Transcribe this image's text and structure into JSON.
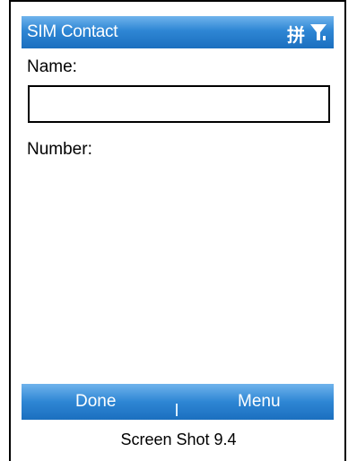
{
  "titlebar": {
    "title": "SIM Contact",
    "ime_indicator": "拼",
    "signal_icon": "signal-antenna-icon"
  },
  "form": {
    "name_label": "Name:",
    "name_value": "",
    "number_label": "Number:"
  },
  "softkeys": {
    "left": "Done",
    "right": "Menu"
  },
  "caption": "Screen Shot 9.4",
  "colors": {
    "bar_blue": "#2e86d4",
    "bar_text": "#ffffff"
  }
}
